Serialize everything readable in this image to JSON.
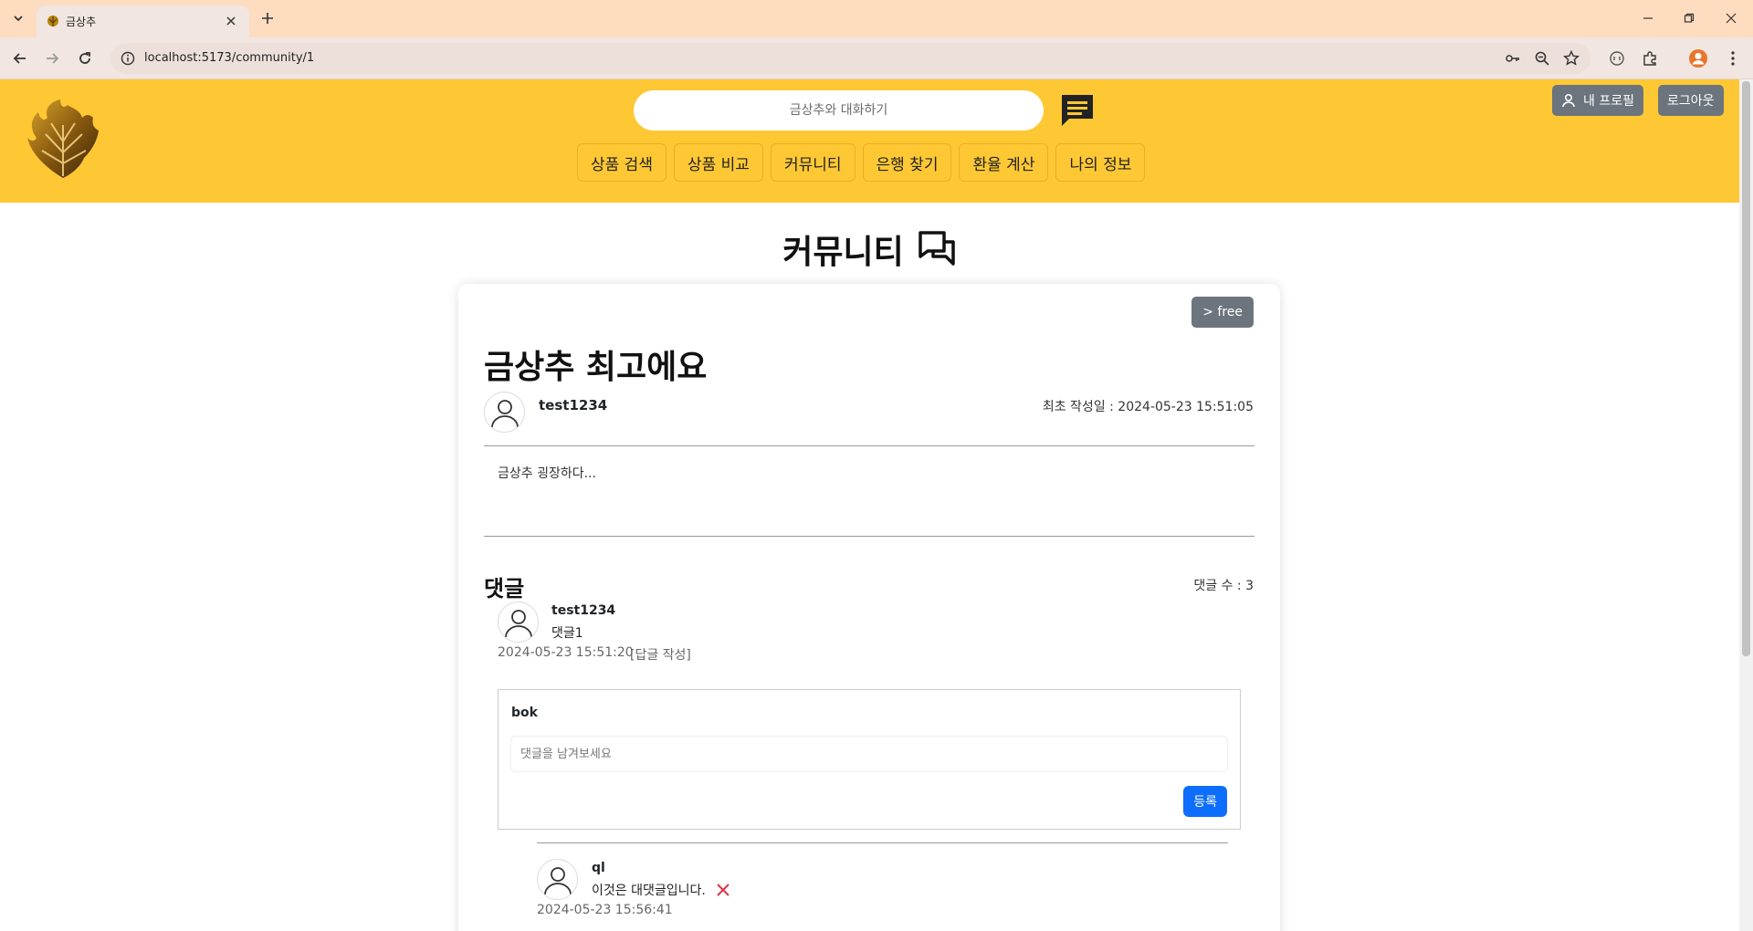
{
  "browser": {
    "tab_title": "금상추",
    "url": "localhost:5173/community/1"
  },
  "header": {
    "search_placeholder": "금상추와 대화하기",
    "nav": [
      "상품 검색",
      "상품 비교",
      "커뮤니티",
      "은행 찾기",
      "환율 계산",
      "나의 정보"
    ],
    "profile_label": "내 프로필",
    "logout_label": "로그아웃",
    "brand_color": "#fec834"
  },
  "page": {
    "title": "커뮤니티"
  },
  "post": {
    "category": "> free",
    "title": "금상추 최고에요",
    "author": "test1234",
    "created": "최초 작성일 : 2024-05-23 15:51:05",
    "body": "금상추 굉장하다..."
  },
  "comments": {
    "title": "댓글",
    "count_label": "댓글 수 : 3",
    "items": [
      {
        "author": "test1234",
        "text": "댓글1",
        "date": "2024-05-23 15:51:20",
        "reply_action": "[답글 작성]"
      }
    ],
    "reply_form": {
      "user": "bok",
      "placeholder": "댓글을 남겨보세요",
      "submit_label": "등록"
    },
    "replies": [
      {
        "author": "ql",
        "text": "이것은 대댓글입니다.",
        "date": "2024-05-23 15:56:41"
      }
    ]
  }
}
